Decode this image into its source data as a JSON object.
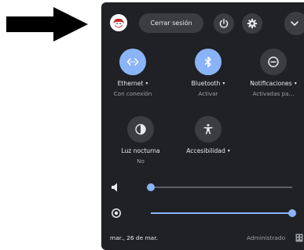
{
  "header": {
    "sign_out_label": "Cerrar sesión"
  },
  "tiles": [
    {
      "label": "Ethernet",
      "sublabel": "Con conexión",
      "icon": "ethernet-icon",
      "active": true,
      "has_menu": true
    },
    {
      "label": "Bluetooth",
      "sublabel": "Activar",
      "icon": "bluetooth-icon",
      "active": true,
      "has_menu": true
    },
    {
      "label": "Notificaciones",
      "sublabel": "Activadas pa...",
      "icon": "do-not-disturb-icon",
      "active": false,
      "has_menu": true
    },
    {
      "label": "Luz nocturna",
      "sublabel": "No",
      "icon": "night-light-icon",
      "active": false,
      "has_menu": false
    },
    {
      "label": "Accesibilidad",
      "sublabel": "",
      "icon": "accessibility-icon",
      "active": false,
      "has_menu": true
    }
  ],
  "sliders": {
    "volume": {
      "icon": "volume-icon",
      "level": 0
    },
    "brightness": {
      "icon": "brightness-icon",
      "level": 1
    }
  },
  "footer": {
    "date": "mar., 26 de mar.",
    "managed": "Administrado"
  },
  "colors": {
    "panel_bg": "#202124",
    "accent": "#8ab4f8",
    "button_bg": "#3c3d40"
  }
}
